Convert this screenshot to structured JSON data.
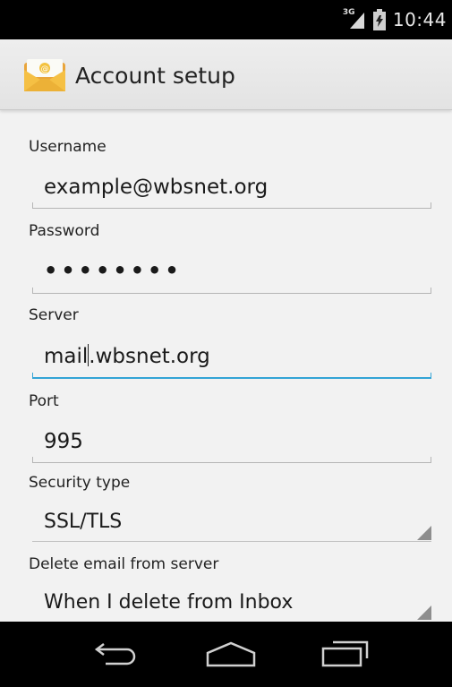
{
  "status_bar": {
    "network_type": "3G",
    "time": "10:44",
    "icons": [
      "signal-icon",
      "battery-icon"
    ]
  },
  "action_bar": {
    "title": "Account setup",
    "icon": "email-app-icon"
  },
  "form": {
    "username": {
      "label": "Username",
      "value": "example@wbsnet.org"
    },
    "password": {
      "label": "Password",
      "value": "••••••••"
    },
    "server": {
      "label": "Server",
      "value_before_cursor": "mail",
      "value_after_cursor": ".wbsnet.org"
    },
    "port": {
      "label": "Port",
      "value": "995"
    },
    "security_type": {
      "label": "Security type",
      "value": "SSL/TLS"
    },
    "delete_email": {
      "label": "Delete email from server",
      "value": "When I delete from Inbox"
    }
  },
  "nav_bar": {
    "buttons": [
      "back-icon",
      "home-icon",
      "recents-icon"
    ]
  },
  "colors": {
    "focus_accent": "#33a4d6",
    "background": "#f2f2f2",
    "system_bar": "#000000"
  }
}
